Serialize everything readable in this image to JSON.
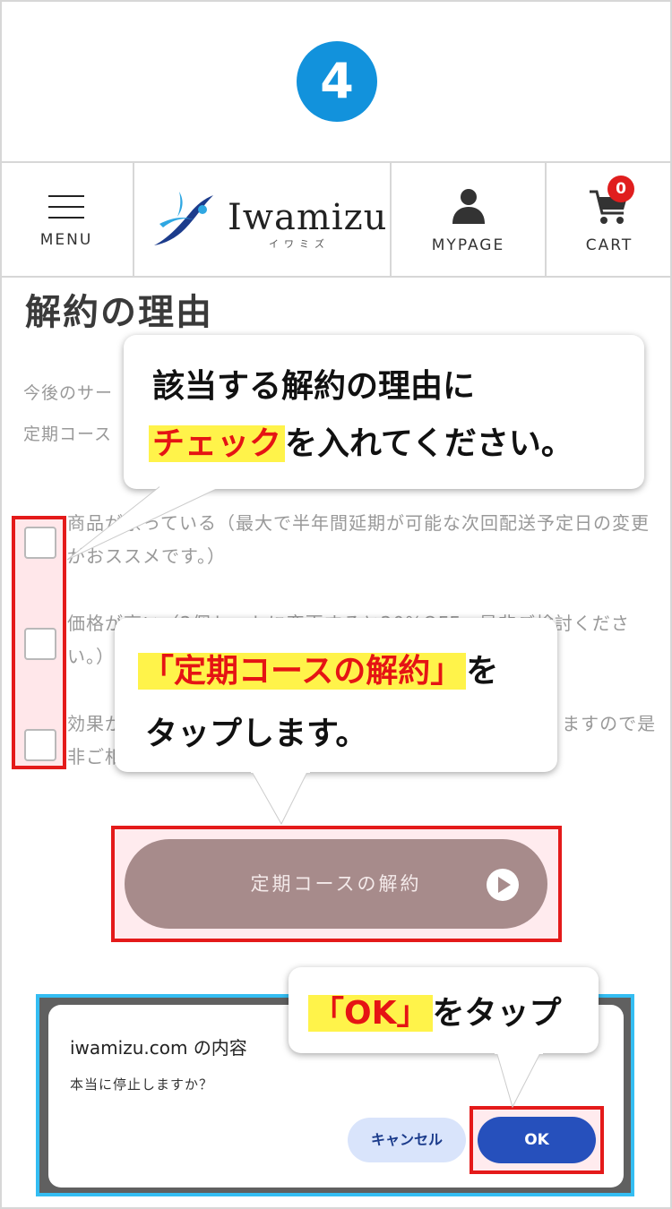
{
  "step": {
    "number": "4"
  },
  "header": {
    "menu_label": "MENU",
    "logo_text": "Iwamizu",
    "logo_sub": "イワミズ",
    "mypage_label": "MYPAGE",
    "cart_label": "CART",
    "cart_count": "0"
  },
  "content": {
    "title": "解約の理由",
    "intro_line1": "今後のサー",
    "intro_line2": "定期コース",
    "reasons": [
      {
        "text": "商品が余っている（最大で半年間延期が可能な次回配送予定日の変更がおススメです。）"
      },
      {
        "text": "価格が高い（2個セットに変更すると20%OFF。是非ご検討ください。）"
      },
      {
        "text": "効果が　　　　　　　　　　　　　　　　　　明してお りますので是非ご相談ください。）"
      }
    ],
    "cancel_button": "定期コースの解約"
  },
  "callouts": {
    "c1_line1": "該当する解約の理由に",
    "c1_hl": "チェック",
    "c1_rest": "を入れてください。",
    "c2_hl": "「定期コースの解約」",
    "c2_rest": "を",
    "c2_line2": "タップします。",
    "c3_hl": "「OK」",
    "c3_rest": "をタップ"
  },
  "dialog": {
    "title": "iwamizu.com の内容",
    "message": "本当に停止しますか？",
    "cancel_label": "キャンセル",
    "ok_label": "OK"
  },
  "colors": {
    "badge": "#1292dc",
    "highlight_red": "#e41a1a",
    "highlight_yellow": "#fff34a",
    "dialog_border": "#34bdf2",
    "ok_button": "#2650bc",
    "cancel_button": "#a78b8b"
  }
}
